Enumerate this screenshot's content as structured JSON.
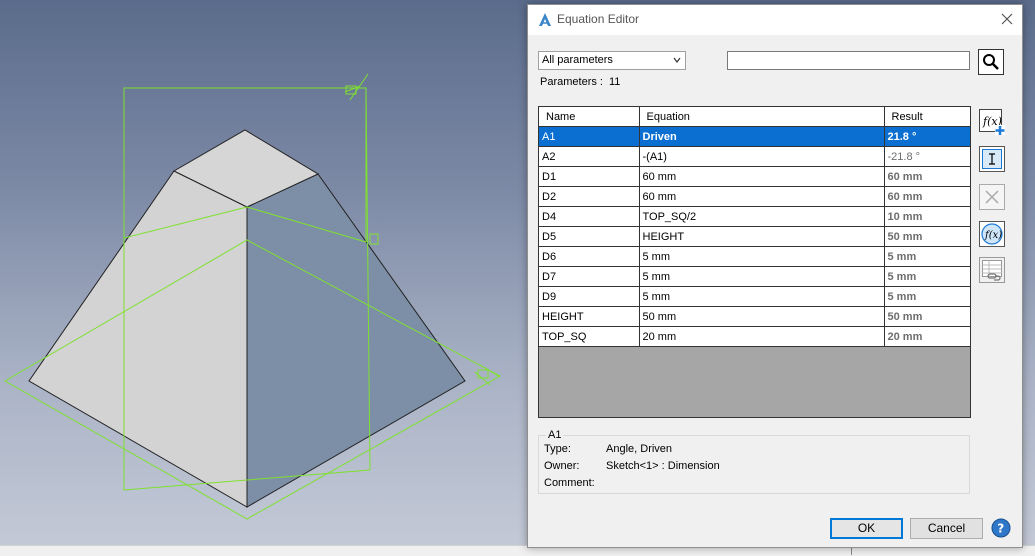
{
  "window": {
    "title": "Equation Editor"
  },
  "filter": {
    "selected": "All parameters"
  },
  "search": {
    "value": ""
  },
  "parameters": {
    "label": "Parameters :",
    "count": "11"
  },
  "table": {
    "headers": {
      "name": "Name",
      "equation": "Equation",
      "result": "Result"
    },
    "rows": [
      {
        "name": "A1",
        "equation": "Driven",
        "result": "21.8 °"
      },
      {
        "name": "A2",
        "equation": "-(A1)",
        "result": "-21.8 °"
      },
      {
        "name": "D1",
        "equation": "60 mm",
        "result": "60 mm"
      },
      {
        "name": "D2",
        "equation": "60 mm",
        "result": "60 mm"
      },
      {
        "name": "D4",
        "equation": "TOP_SQ/2",
        "result": "10 mm"
      },
      {
        "name": "D5",
        "equation": "HEIGHT",
        "result": "50 mm"
      },
      {
        "name": "D6",
        "equation": "5 mm",
        "result": "5 mm"
      },
      {
        "name": "D7",
        "equation": "5 mm",
        "result": "5 mm"
      },
      {
        "name": "D9",
        "equation": "5 mm",
        "result": "5 mm"
      },
      {
        "name": "HEIGHT",
        "equation": "50 mm",
        "result": "50 mm"
      },
      {
        "name": "TOP_SQ",
        "equation": "20 mm",
        "result": "20 mm"
      }
    ]
  },
  "details": {
    "title": "A1",
    "type_label": "Type:",
    "type_value": "Angle, Driven",
    "owner_label": "Owner:",
    "owner_value": "Sketch<1> : Dimension",
    "comment_label": "Comment:",
    "comment_value": ""
  },
  "buttons": {
    "ok": "OK",
    "cancel": "Cancel"
  },
  "icons": {
    "app": "app-logo-icon",
    "close": "close-icon",
    "search": "magnifier-icon",
    "add_parameter": "fx-add-icon",
    "rename": "text-cursor-icon",
    "delete": "delete-x-icon",
    "function": "fx-function-icon",
    "link_table": "table-link-icon",
    "help": "help-icon"
  },
  "colors": {
    "selection": "#0a6fd0",
    "sketch_lines": "#7fe030",
    "viewport_top": "#5a6b8b",
    "viewport_bottom": "#c3c9d6"
  }
}
